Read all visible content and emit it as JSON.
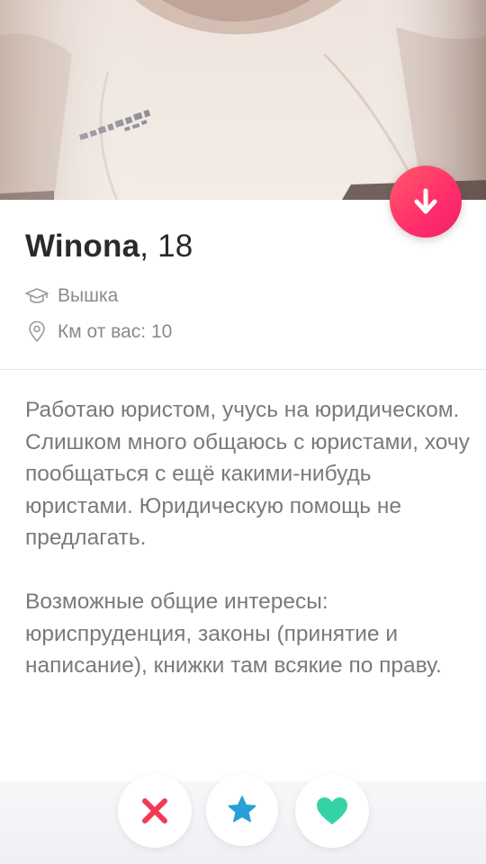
{
  "profile": {
    "name": "Winona",
    "age_text": ", 18",
    "school": "Вышка",
    "distance": "Км от вас: 10"
  },
  "bio": {
    "paragraph_1": "Работаю юристом, учусь на юридическом. Слишком много общаюсь с юристами, хочу пообщаться с ещё какими-нибудь юристами. Юридическую помощь не предлагать.",
    "paragraph_2": "Возможные общие интересы: юриспруденция, законы (принятие и написание), книжки там всякие по праву."
  },
  "icons": {
    "collapse": "arrow-down-icon",
    "school": "graduation-cap-icon",
    "distance": "location-pin-icon",
    "nope": "close-icon",
    "super_like": "star-icon",
    "like": "heart-icon"
  },
  "colors": {
    "accent_red": "#ff2d6a",
    "nope": "#f23a57",
    "super_like": "#2a9fd8",
    "like": "#34d3a6",
    "name_text": "#2a2a2a",
    "secondary_text": "#8a8a8a"
  }
}
